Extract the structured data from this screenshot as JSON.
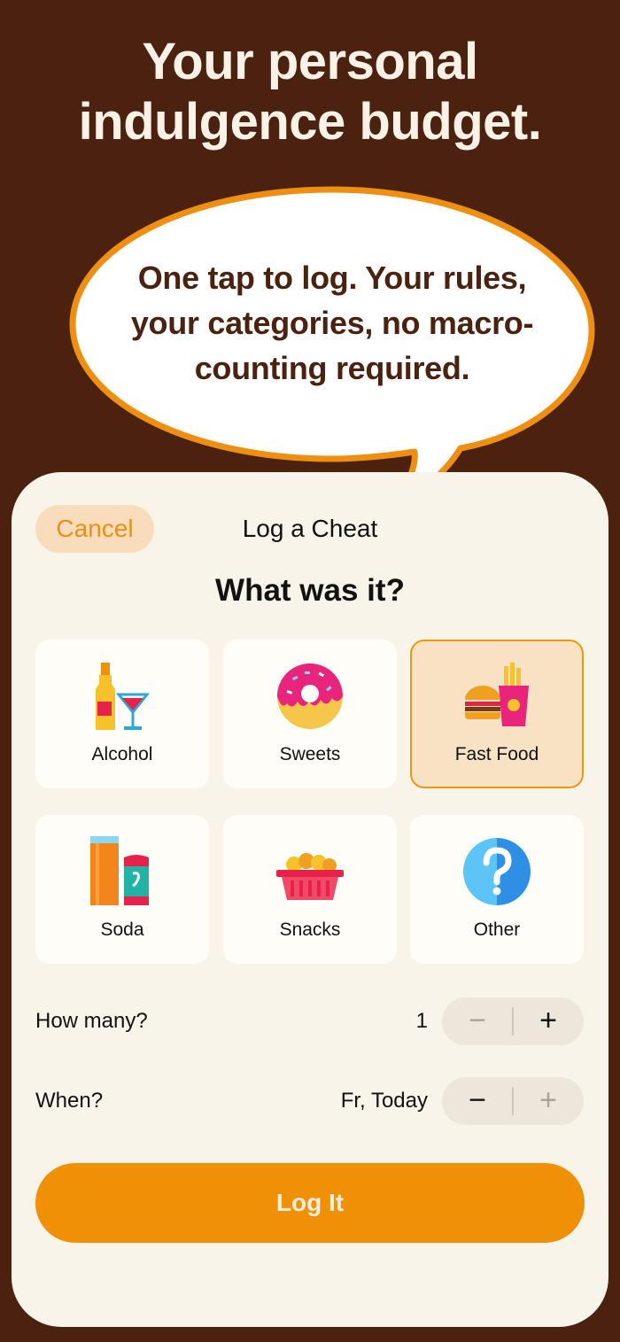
{
  "headline": {
    "line1": "Your personal",
    "line2": "indulgence budget."
  },
  "bubble": {
    "line1": "One tap to log. Your rules,",
    "line2": "your categories, no macro-",
    "line3": "counting required."
  },
  "sheet": {
    "cancel_label": "Cancel",
    "title": "Log a Cheat",
    "question": "What was it?",
    "categories": [
      {
        "label": "Alcohol",
        "icon": "alcohol-bottle-glass-icon",
        "selected": false
      },
      {
        "label": "Sweets",
        "icon": "donut-icon",
        "selected": false
      },
      {
        "label": "Fast Food",
        "icon": "burger-fries-icon",
        "selected": true
      },
      {
        "label": "Soda",
        "icon": "soda-can-icon",
        "selected": false
      },
      {
        "label": "Snacks",
        "icon": "snack-basket-icon",
        "selected": false
      },
      {
        "label": "Other",
        "icon": "question-icon",
        "selected": false
      }
    ],
    "quantity": {
      "label": "How many?",
      "value": "1",
      "minus": "−",
      "plus": "+"
    },
    "when": {
      "label": "When?",
      "value": "Fr, Today",
      "minus": "−",
      "plus": "+"
    },
    "submit_label": "Log It"
  },
  "colors": {
    "background": "#4a220f",
    "accent": "#f09105",
    "sheet": "#f9f4ea",
    "selected_tile": "#f8e2c4"
  }
}
